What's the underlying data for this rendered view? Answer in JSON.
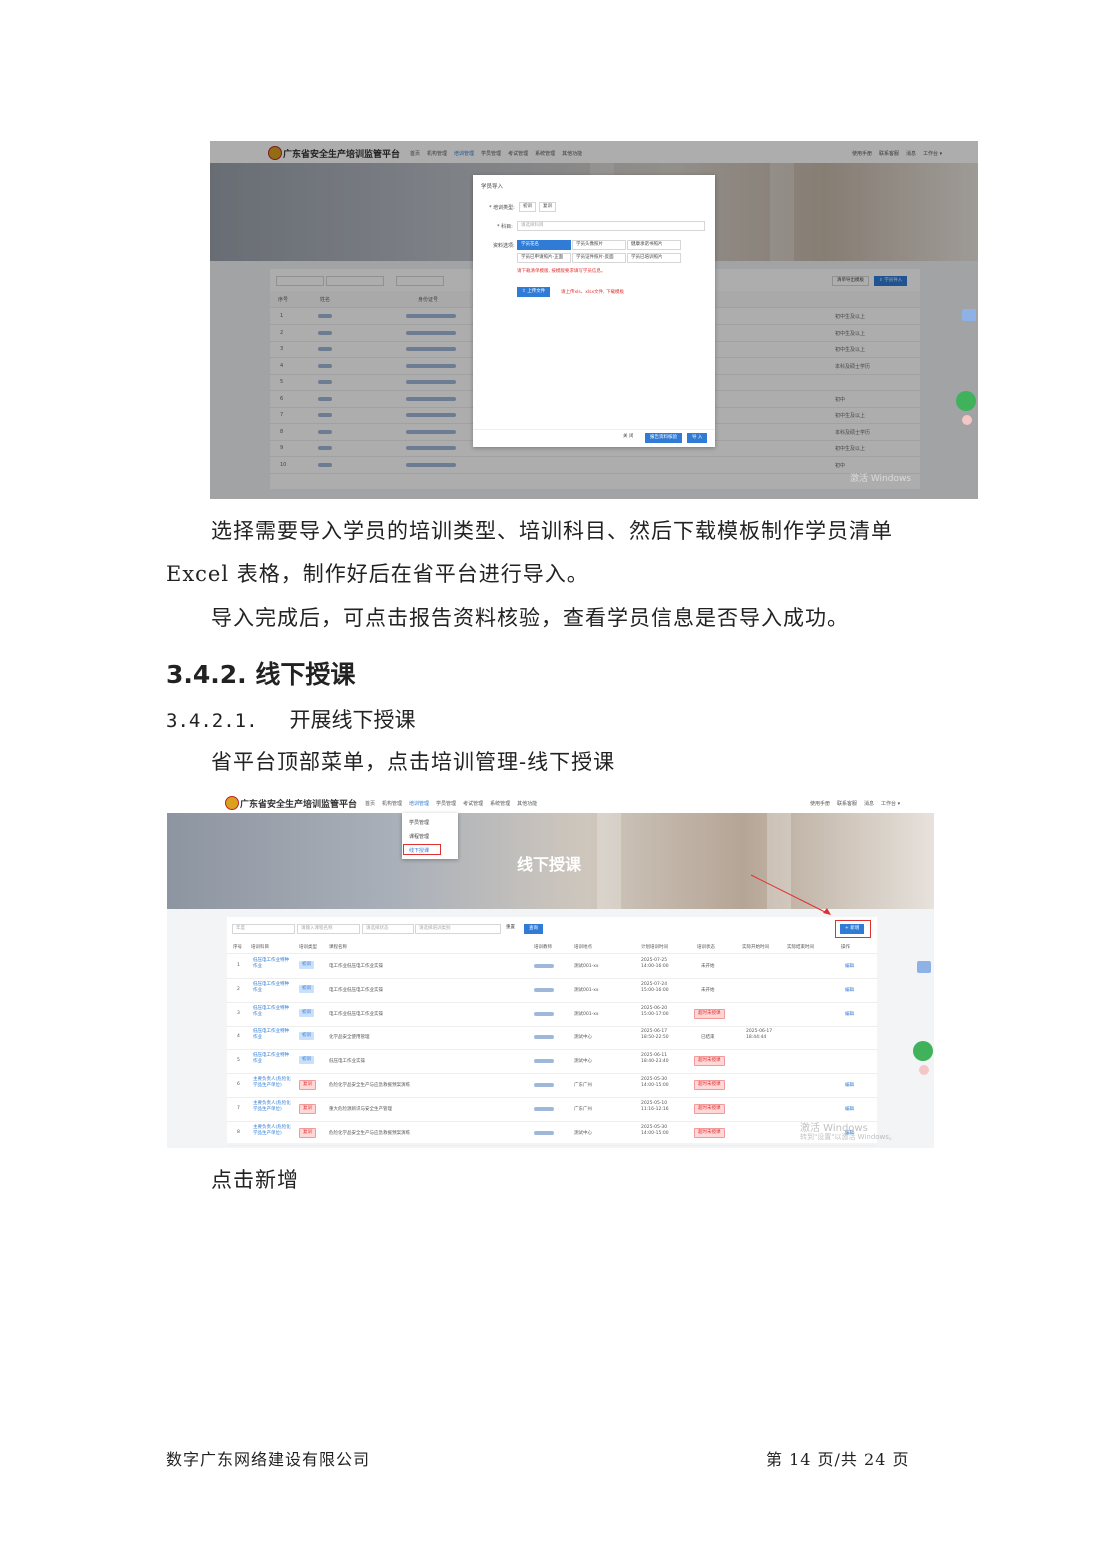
{
  "screenshot1": {
    "brand": "广东省安全生产培训监管平台",
    "menu": [
      "首页",
      "机构管理",
      "培训管理",
      "学员管理",
      "考试管理",
      "系统管理",
      "其他功能"
    ],
    "right_tools": [
      "使用手册",
      "联系客服",
      "消息",
      "工作台 ▾"
    ],
    "dialog": {
      "title": "学员导入",
      "type_label": "* 培训类型:",
      "type_options": [
        "初训",
        "复训"
      ],
      "subject_label": "* 科目:",
      "subject_placeholder": "请选择科目",
      "material_label": "资料选项:",
      "materials": [
        "学员花名",
        "学员头像照片",
        "健康承诺书照片",
        "学员已申请照片-正面",
        "学员证件照片-反面",
        "学员已培训照片"
      ],
      "hint": "请下载清单模版, 按模版要求填写学员信息。",
      "upload_btn": "⇪ 上传文件",
      "upload_hint": "请上传xls、xlsx文件, 下载模板",
      "footer_btns": [
        "关 闭",
        "报告资料核验",
        "导 入"
      ]
    },
    "list_toolbar": [
      "清单导出模板",
      "⇪ 学员导入"
    ],
    "list_headers": [
      "序号",
      "姓名",
      "身份证号"
    ],
    "row_numbers": [
      "1",
      "2",
      "3",
      "4",
      "5",
      "6",
      "7",
      "8",
      "9",
      "10"
    ],
    "right_col": [
      "初中生及以上",
      "初中生及以上",
      "初中生及以上",
      "本科及硕士学历",
      "",
      "初中",
      "初中生及以上",
      "本科及硕士学历",
      "初中生及以上",
      "初中"
    ],
    "watermark": "激活 Windows"
  },
  "para1_line1": "选择需要导入学员的培训类型、培训科目、然后下载模板制作学员清单",
  "para1_line2": "Excel 表格，制作好后在省平台进行导入。",
  "para2": "导入完成后，可点击报告资料核验，查看学员信息是否导入成功。",
  "h3": "3.4.2. 线下授课",
  "h4_num": "3.4.2.1.",
  "h4_title": "开展线下授课",
  "para3": "省平台顶部菜单，点击培训管理-线下授课",
  "screenshot2": {
    "brand": "广东省安全生产培训监管平台",
    "menu": [
      "首页",
      "机构管理",
      "培训管理",
      "学员管理",
      "考试管理",
      "系统管理",
      "其他功能"
    ],
    "right_tools": [
      "使用手册",
      "联系客服",
      "消息",
      "工作台 ▾"
    ],
    "dropdown": [
      "学员管理",
      "课程管理",
      "线下授课"
    ],
    "banner_title": "线下授课",
    "filters": [
      "年度",
      "请输入课程名称",
      "请选择状态",
      "请选择培训类别"
    ],
    "search_btns": [
      "重置",
      "查询"
    ],
    "add_btn": "+ 新增",
    "headers": [
      "序号",
      "培训科目",
      "培训类型",
      "课程名称",
      "培训教师",
      "培训地点",
      "计划培训时间",
      "培训状态",
      "实际开始时间",
      "实际结束时间",
      "操作"
    ],
    "rows": [
      {
        "no": "1",
        "subject": "低压电工作业特种作业",
        "type": "初训",
        "course": "电工作业低压电工作业实操",
        "place": "测试001-xx",
        "time": "2025-07-25 14:00-16:00",
        "status": "未开始",
        "status_red": false,
        "start": "",
        "op": "编辑"
      },
      {
        "no": "2",
        "subject": "低压电工作业特种作业",
        "type": "初训",
        "course": "电工作业低压电工作业实操",
        "place": "测试001-xx",
        "time": "2025-07-24 15:00-16:00",
        "status": "未开始",
        "status_red": false,
        "start": "",
        "op": "编辑"
      },
      {
        "no": "3",
        "subject": "低压电工作业特种作业",
        "type": "初训",
        "course": "电工作业低压电工作业实操",
        "place": "测试001-xx",
        "time": "2025-06-20 15:00-17:00",
        "status": "超时未授课",
        "status_red": true,
        "start": "",
        "op": "编辑"
      },
      {
        "no": "4",
        "subject": "低压电工作业特种作业",
        "type": "初训",
        "course": "化学品安全使用管理",
        "place": "测试中心",
        "time": "2025-06-17 18:50-22:50",
        "status": "已结束",
        "status_red": false,
        "start": "2025-06-17 18:44:44",
        "op": ""
      },
      {
        "no": "5",
        "subject": "低压电工作业特种作业",
        "type": "初训",
        "course": "低压电工作业实操",
        "place": "测试中心",
        "time": "2025-06-11 18:40-23:40",
        "status": "超时未授课",
        "status_red": true,
        "start": "",
        "op": ""
      },
      {
        "no": "6",
        "subject": "主要负责人(危险化学品生产单位)",
        "type": "复训",
        "course": "危险化学品安全生产与应急救援预案演练",
        "place": "广东广州",
        "time": "2025-05-30 14:00-15:00",
        "status": "超时未授课",
        "status_red": true,
        "start": "",
        "op": "编辑"
      },
      {
        "no": "7",
        "subject": "主要负责人(危险化学品生产单位)",
        "type": "复训",
        "course": "重大危险源辨识与安全生产管理",
        "place": "广东广州",
        "time": "2025-05-10 11:16-12:16",
        "status": "超时未授课",
        "status_red": true,
        "start": "",
        "op": "编辑"
      },
      {
        "no": "8",
        "subject": "主要负责人(危险化学品生产单位)",
        "type": "复训",
        "course": "危险化学品安全生产与应急救援预案演练",
        "place": "测试中心",
        "time": "2025-05-30 14:00-15:00",
        "status": "超时未授课",
        "status_red": true,
        "start": "",
        "op": "编辑"
      }
    ],
    "watermark1": "激活 Windows",
    "watermark2": "转到\"设置\"以激活 Windows。"
  },
  "para4": "点击新增",
  "footer_left": "数字广东网络建设有限公司",
  "footer_right": "第 14 页/共 24 页"
}
